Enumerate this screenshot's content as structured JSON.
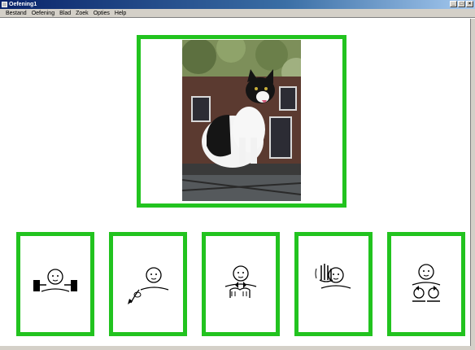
{
  "window": {
    "title": "Oefening1",
    "controls": [
      "_",
      "□",
      "×"
    ]
  },
  "menu": [
    "Bestand",
    "Oefening",
    "Blad",
    "Zoek",
    "Opties",
    "Help"
  ],
  "main_image": {
    "subject": "photo of a black and white cat sitting on a wall"
  },
  "cards": [
    {
      "icon": "sign-both-hands-raised-icon"
    },
    {
      "icon": "sign-hand-pointing-down-icon"
    },
    {
      "icon": "sign-hands-at-chest-icon"
    },
    {
      "icon": "sign-hand-at-face-icon"
    },
    {
      "icon": "sign-two-circles-icon"
    }
  ],
  "colors": {
    "card_border": "#22c31f",
    "titlebar": "#0a246a",
    "menubar": "#d4d0c8"
  }
}
